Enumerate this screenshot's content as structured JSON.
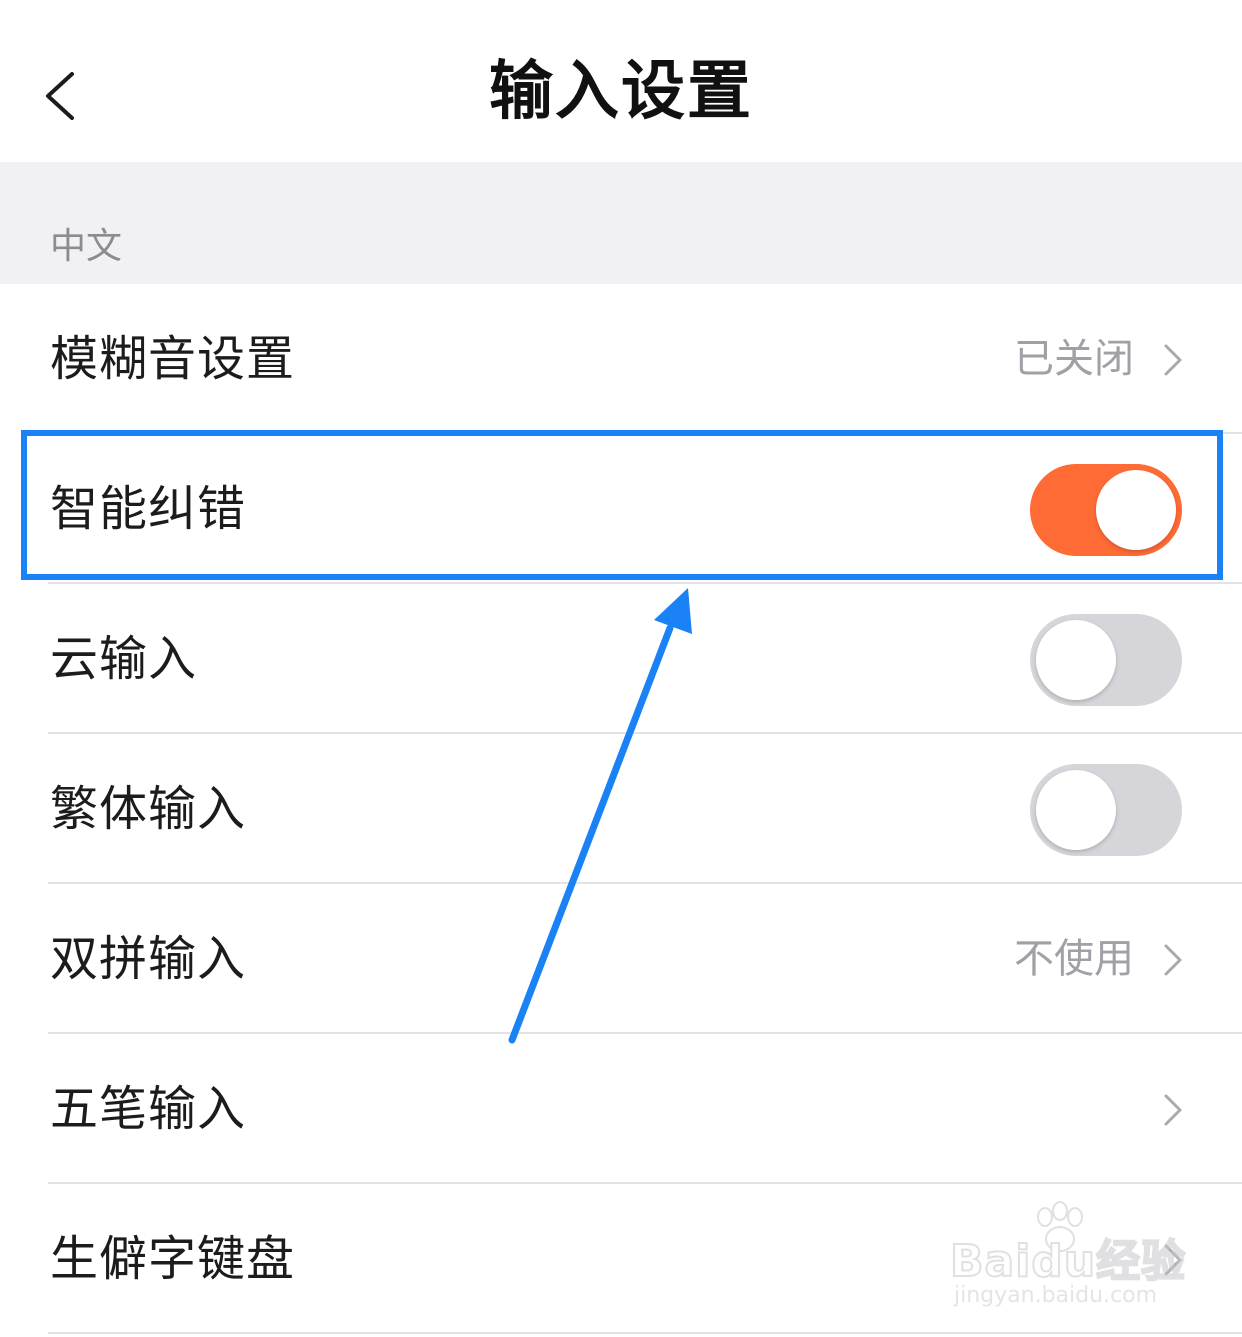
{
  "header": {
    "title": "输入设置",
    "back_icon": "chevron-left-icon"
  },
  "section": {
    "title": "中文"
  },
  "rows": [
    {
      "label": "模糊音设置",
      "type": "link",
      "value": "已关闭"
    },
    {
      "label": "智能纠错",
      "type": "toggle",
      "enabled": true,
      "highlighted": true
    },
    {
      "label": "云输入",
      "type": "toggle",
      "enabled": false
    },
    {
      "label": "繁体输入",
      "type": "toggle",
      "enabled": false
    },
    {
      "label": "双拼输入",
      "type": "link",
      "value": "不使用"
    },
    {
      "label": "五笔输入",
      "type": "link",
      "value": ""
    },
    {
      "label": "生僻字键盘",
      "type": "link",
      "value": ""
    }
  ],
  "colors": {
    "toggle_on": "#ff6b35",
    "toggle_off": "#d5d5da",
    "annotation_blue": "#1a82f5",
    "section_band": "#f0f0f5"
  },
  "watermark": {
    "brand": "Baidu经验",
    "url": "jingyan.baidu.com"
  }
}
